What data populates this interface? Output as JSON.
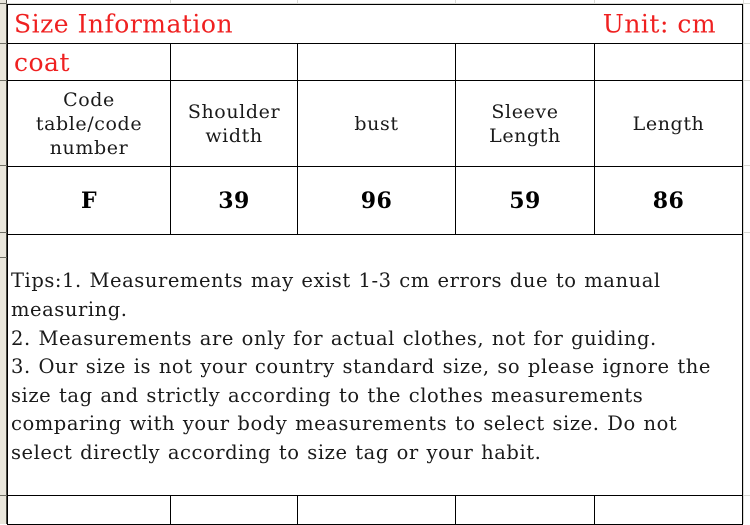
{
  "document": {
    "title": "Size Information",
    "unit_label": "Unit: cm",
    "category": "coat"
  },
  "table": {
    "columns": [
      "Code table/code number",
      "Shoulder width",
      "bust",
      "Sleeve Length",
      "Length"
    ],
    "rows": [
      {
        "code": "F",
        "shoulder_width": "39",
        "bust": "96",
        "sleeve_length": "59",
        "length": "86"
      }
    ]
  },
  "tips": {
    "line1": "Tips:1. Measurements may exist 1-3 cm errors due to manual measuring.",
    "line2": "2. Measurements are only for actual clothes, not for guiding.",
    "line3": "3. Our size is not your country standard size, so please ignore the size tag and strictly according to the clothes measurements comparing with your body measurements to select size. Do not select directly according to size tag or your habit."
  },
  "colors": {
    "title_red": "#ef2020",
    "text_black": "#1a1a1a",
    "border": "#000000",
    "gutter": "#eae7dc",
    "grid_faint": "#d9d9d4"
  }
}
